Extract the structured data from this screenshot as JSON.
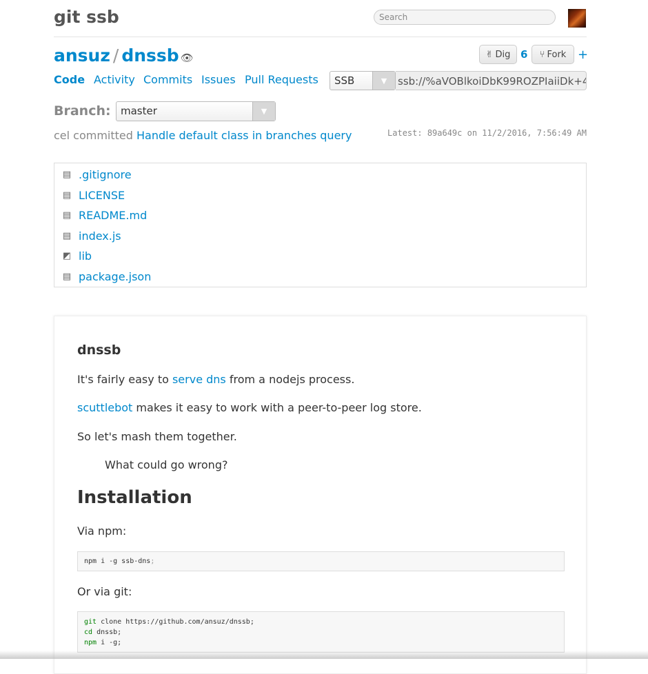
{
  "header": {
    "site_title": "git ssb",
    "search_placeholder": "Search"
  },
  "repo": {
    "owner": "ansuz",
    "separator": "/",
    "name": "dnssb",
    "hidden_icon": "👁",
    "dig_icon": "✌",
    "dig_label": "Dig",
    "dig_count": "6",
    "fork_icon": "⑂",
    "fork_label": "Fork",
    "fork_plus": "+"
  },
  "nav": {
    "tabs": [
      "Code",
      "Activity",
      "Commits",
      "Issues",
      "Pull Requests"
    ],
    "active": "Code"
  },
  "clone": {
    "protocol": "SSB",
    "url": "ssb://%aVOBlkoiDbK99ROZPIaiiDk+4"
  },
  "branch": {
    "label": "Branch:",
    "selected": "master"
  },
  "commit": {
    "author_text": "cel committed",
    "message": "Handle default class in branches query",
    "latest": "Latest: 89a649c on 11/2/2016, 7:56:49 AM"
  },
  "files": [
    {
      "name": ".gitignore",
      "icon": "file-icon"
    },
    {
      "name": "LICENSE",
      "icon": "file-icon"
    },
    {
      "name": "README.md",
      "icon": "file-icon"
    },
    {
      "name": "index.js",
      "icon": "file-icon"
    },
    {
      "name": "lib",
      "icon": "folder-icon"
    },
    {
      "name": "package.json",
      "icon": "file-icon"
    }
  ],
  "readme": {
    "title": "dnssb",
    "p1_before": "It's fairly easy to",
    "p1_link": "serve dns",
    "p1_after": "from a nodejs process.",
    "p2_link": "scuttlebot",
    "p2_after": "makes it easy to work with a peer-to-peer log store.",
    "p3": "So let's mash them together.",
    "quote": "What could go wrong?",
    "install_heading": "Installation",
    "via_npm": "Via npm:",
    "npm_code": "npm i -g ssb-dns",
    "npm_code_semicolon": ";",
    "or_via_git": "Or via git:",
    "git_lines": [
      {
        "cmd": "git",
        "rest": " clone https://github.com/ansuz/dnssb;"
      },
      {
        "cmd": "cd",
        "rest": " dnssb;"
      },
      {
        "cmd": "npm",
        "rest": " i -g;"
      }
    ]
  }
}
